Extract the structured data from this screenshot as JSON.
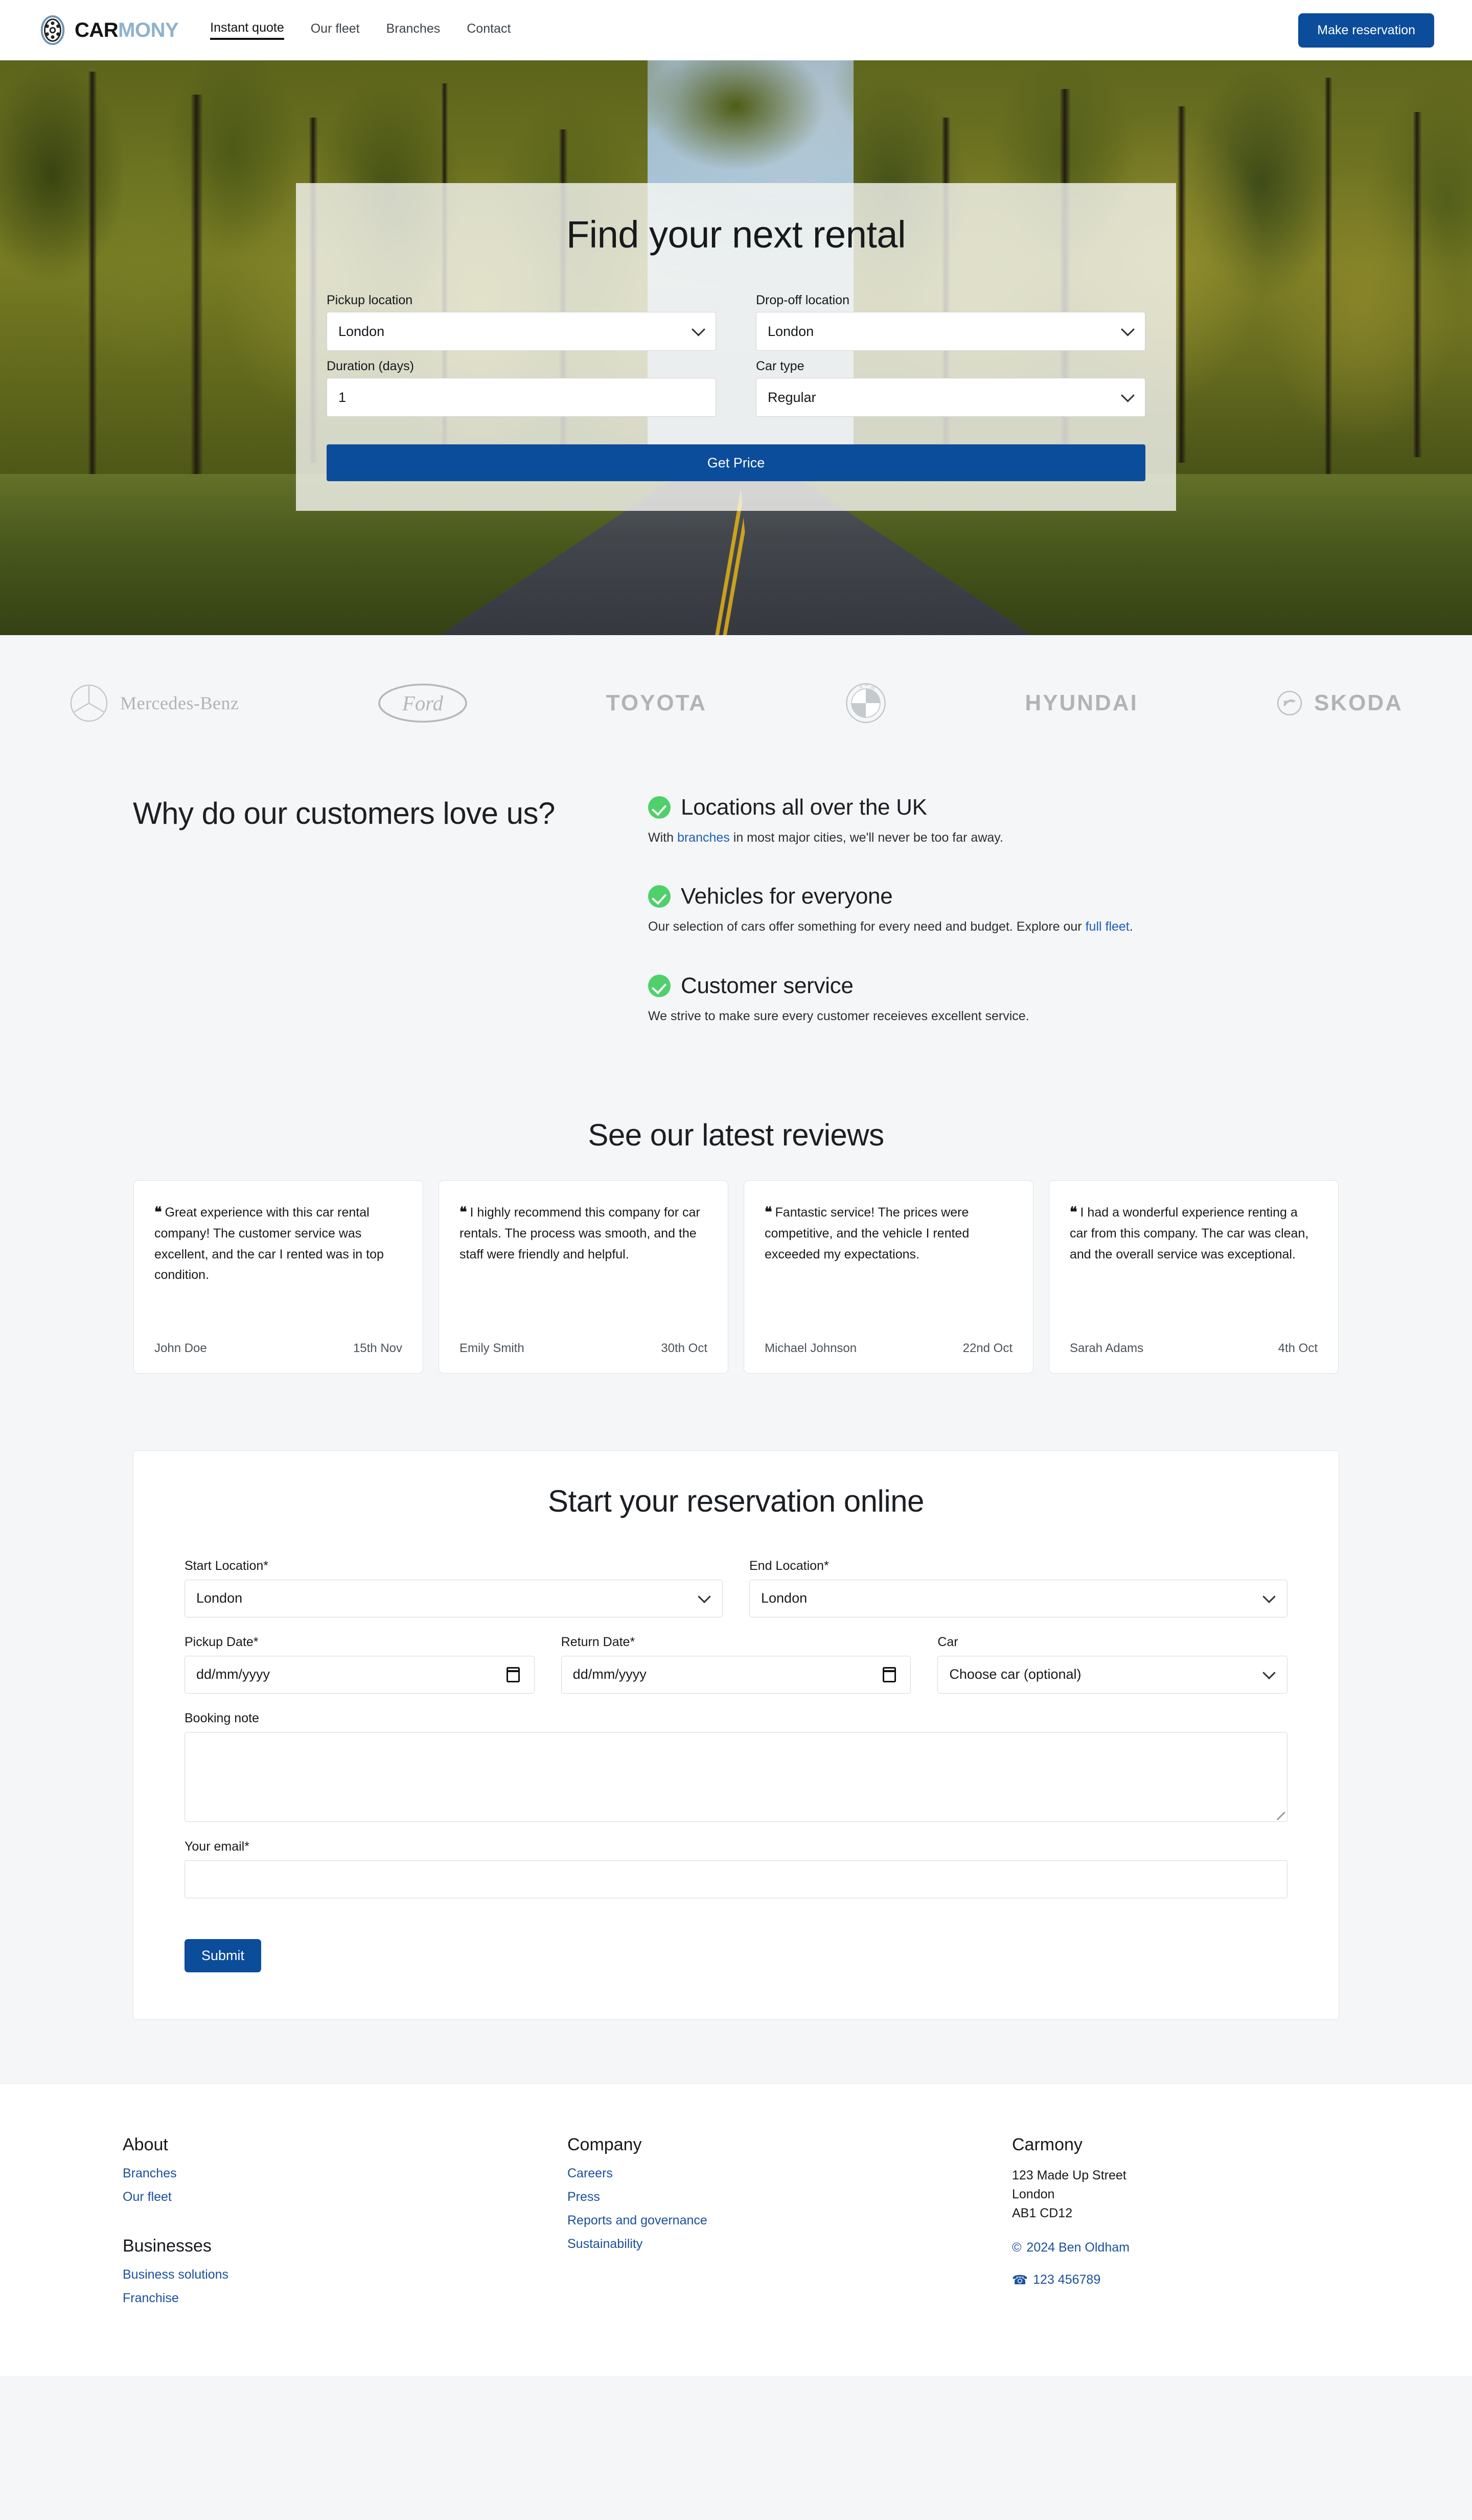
{
  "header": {
    "brand_car": "CAR",
    "brand_mony": "MONY",
    "logo_icon": "wheel-icon",
    "nav": [
      {
        "label": "Instant quote",
        "active": true
      },
      {
        "label": "Our fleet",
        "active": false
      },
      {
        "label": "Branches",
        "active": false
      },
      {
        "label": "Contact",
        "active": false
      }
    ],
    "reserve_button": "Make reservation"
  },
  "hero": {
    "title": "Find your next rental",
    "pickup_label": "Pickup location",
    "pickup_value": "London",
    "dropoff_label": "Drop-off location",
    "dropoff_value": "London",
    "duration_label": "Duration (days)",
    "duration_value": "1",
    "cartype_label": "Car type",
    "cartype_value": "Regular",
    "submit": "Get Price"
  },
  "brands": [
    {
      "name": "Mercedes-Benz",
      "icon": "mercedes-star-icon"
    },
    {
      "name": "Ford",
      "icon": "ford-oval-icon"
    },
    {
      "name": "TOYOTA",
      "icon": "toyota-wordmark-icon"
    },
    {
      "name": "BMW",
      "icon": "bmw-roundel-icon"
    },
    {
      "name": "HYUNDAI",
      "icon": "hyundai-wordmark-icon"
    },
    {
      "name": "SKODA",
      "icon": "skoda-arrow-icon"
    }
  ],
  "why": {
    "heading": "Why do our customers love us?",
    "features": [
      {
        "title": "Locations all over the UK",
        "desc_pre": "With ",
        "link": "branches",
        "desc_post": " in most major cities, we'll never be too far away."
      },
      {
        "title": "Vehicles for everyone",
        "desc_pre": "Our selection of cars offer something for every need and budget. Explore our ",
        "link": "full fleet",
        "desc_post": "."
      },
      {
        "title": "Customer service",
        "desc_pre": "We strive to make sure every customer receieves excellent service.",
        "link": "",
        "desc_post": ""
      }
    ]
  },
  "reviews": {
    "title": "See our latest reviews",
    "items": [
      {
        "quote": "Great experience with this car rental company! The customer service was excellent, and the car I rented was in top condition.",
        "author": "John Doe",
        "date": "15th Nov"
      },
      {
        "quote": "I highly recommend this company for car rentals. The process was smooth, and the staff were friendly and helpful.",
        "author": "Emily Smith",
        "date": "30th Oct"
      },
      {
        "quote": "Fantastic service! The prices were competitive, and the vehicle I rented exceeded my expectations.",
        "author": "Michael Johnson",
        "date": "22nd Oct"
      },
      {
        "quote": "I had a wonderful experience renting a car from this company. The car was clean, and the overall service was exceptional.",
        "author": "Sarah Adams",
        "date": "4th Oct"
      }
    ]
  },
  "reservation": {
    "title": "Start your reservation online",
    "start_location_label": "Start Location*",
    "start_location_value": "London",
    "end_location_label": "End Location*",
    "end_location_value": "London",
    "pickup_date_label": "Pickup Date*",
    "pickup_date_placeholder": "dd/mm/yyyy",
    "return_date_label": "Return Date*",
    "return_date_placeholder": "dd/mm/yyyy",
    "car_label": "Car",
    "car_value": "Choose car (optional)",
    "note_label": "Booking note",
    "note_value": "",
    "email_label": "Your email*",
    "email_value": "",
    "submit": "Submit"
  },
  "footer": {
    "about_heading": "About",
    "about_links": [
      "Branches",
      "Our fleet"
    ],
    "businesses_heading": "Businesses",
    "businesses_links": [
      "Business solutions",
      "Franchise"
    ],
    "company_heading": "Company",
    "company_links": [
      "Careers",
      "Press",
      "Reports and governance",
      "Sustainability"
    ],
    "contact_heading": "Carmony",
    "address_line1": "123 Made Up Street",
    "address_line2": "London",
    "address_line3": "AB1 CD12",
    "copyright_icon": "copyright-icon",
    "copyright": "2024 Ben Oldham",
    "phone_icon": "phone-icon",
    "phone": "123 456789"
  },
  "colors": {
    "accent_blue": "#0b4c9b",
    "link_blue": "#1a5fb4",
    "check_green": "#4fd06b",
    "brand_light": "#8fb2cc"
  }
}
